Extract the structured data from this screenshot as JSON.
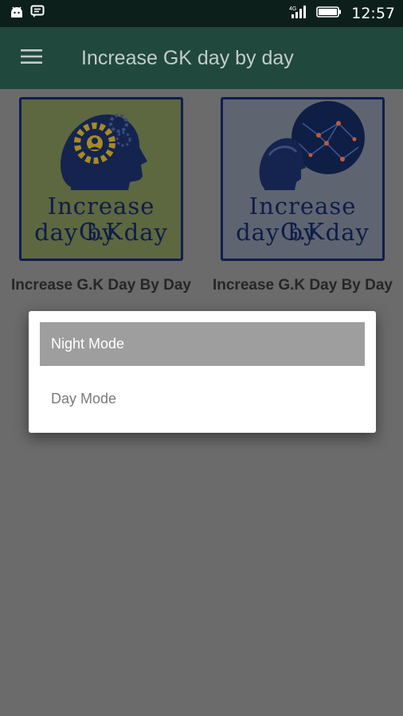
{
  "status_bar": {
    "time": "12:57",
    "icons": [
      "android-icon",
      "message-icon",
      "signal-icon",
      "battery-icon"
    ]
  },
  "app_bar": {
    "title": "Increase GK day by day",
    "menu_icon": "hamburger-menu-icon"
  },
  "cards": [
    {
      "thumb_line1": "Increase G.K",
      "thumb_line2": "day by day",
      "caption": "Increase G.K Day By Day"
    },
    {
      "thumb_line1": "Increase G.K",
      "thumb_line2": "day by day",
      "caption": "Increase G.K Day By Day"
    }
  ],
  "dialog": {
    "options": [
      {
        "label": "Night Mode",
        "selected": true
      },
      {
        "label": "Day Mode",
        "selected": false
      }
    ]
  },
  "colors": {
    "app_bar": "#21483d",
    "status_bar": "#0c1f1a",
    "scrim": "#6b6b6b",
    "selected_option": "#9e9e9e"
  }
}
